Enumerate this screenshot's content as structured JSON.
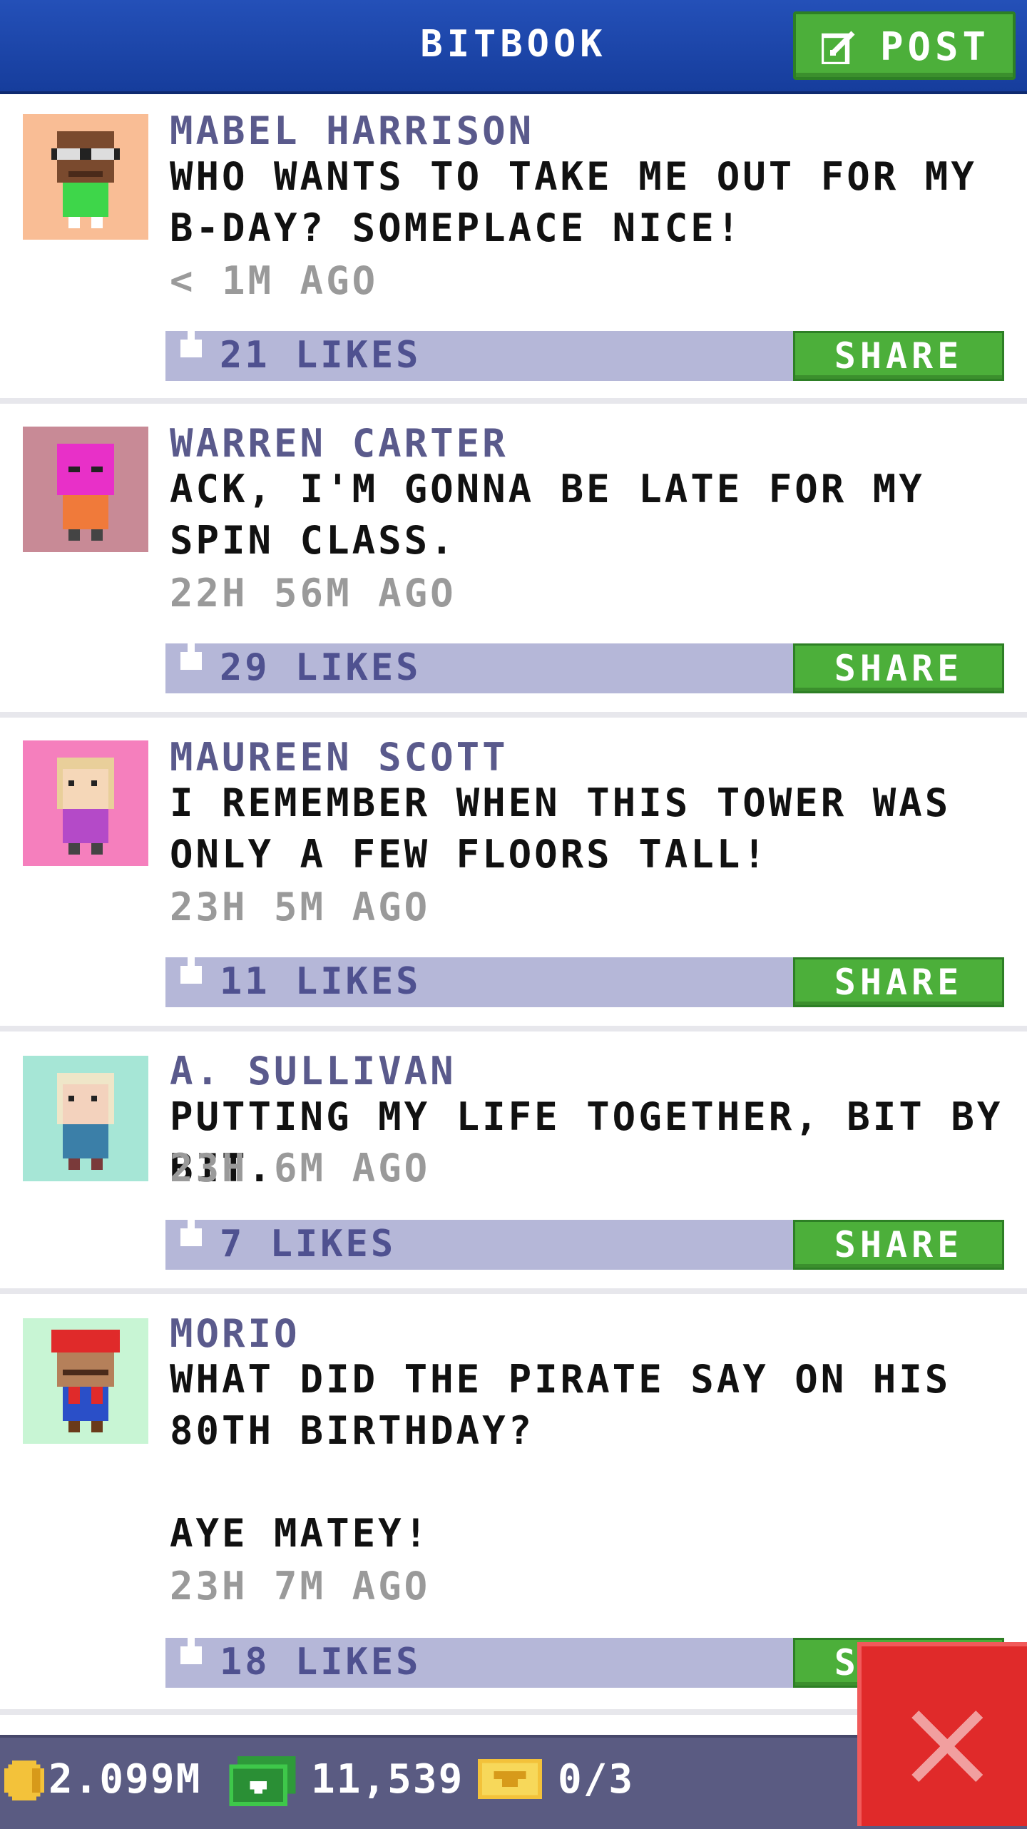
{
  "header": {
    "title": "BITBOOK",
    "post_label": "POST"
  },
  "posts": [
    {
      "author": "MABEL HARRISON",
      "message": "WHO WANTS TO TAKE ME OUT FOR MY B-DAY? SOMEPLACE NICE!",
      "time": "< 1M AGO",
      "likes": "21 LIKES",
      "share_label": "SHARE",
      "avatar_bg": "#f9bd95"
    },
    {
      "author": "WARREN CARTER",
      "message": "ACK, I'M GONNA BE LATE FOR MY SPIN CLASS.",
      "time": "22H 56M AGO",
      "likes": "29 LIKES",
      "share_label": "SHARE",
      "avatar_bg": "#c88a96"
    },
    {
      "author": "MAUREEN SCOTT",
      "message": "I REMEMBER WHEN THIS TOWER WAS ONLY A FEW FLOORS TALL!",
      "time": "23H 5M AGO",
      "likes": "11 LIKES",
      "share_label": "SHARE",
      "avatar_bg": "#f57fbd"
    },
    {
      "author": "A. SULLIVAN",
      "message": "PUTTING MY LIFE TOGETHER, BIT BY BIT.",
      "time": "23H 6M AGO",
      "likes": "7 LIKES",
      "share_label": "SHARE",
      "avatar_bg": "#a6e6d6"
    },
    {
      "author": "MORIO",
      "message": "WHAT DID THE PIRATE SAY ON HIS 80TH BIRTHDAY?\n\nAYE MATEY!",
      "time": "23H 7M AGO",
      "likes": "18 LIKES",
      "share_label": "SHARE",
      "avatar_bg": "#c8f5d4"
    }
  ],
  "footer": {
    "coins": "2.099M",
    "cash": "11,539",
    "tickets": "0/3"
  },
  "icons": {
    "post": "edit-icon",
    "like": "thumbs-up-icon",
    "coin": "coin-icon",
    "cash": "cash-icon",
    "ticket": "ticket-icon",
    "close": "close-icon"
  },
  "colors": {
    "header": "#1f4bb0",
    "button_green": "#4caf3a",
    "like_bar": "#b5b7d8",
    "author": "#5a5a8c",
    "bottom_bar": "#5a5b82",
    "close_red": "#e02a2a"
  }
}
